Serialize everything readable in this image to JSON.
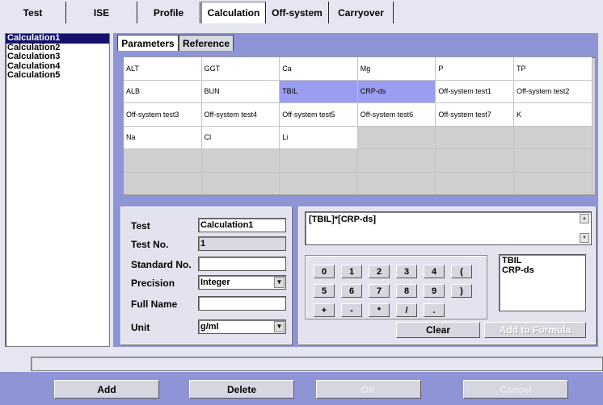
{
  "top_tabs": [
    {
      "label": "Test"
    },
    {
      "label": "ISE"
    },
    {
      "label": "Profile"
    },
    {
      "label": "Calculation",
      "active": true
    },
    {
      "label": "Off-system"
    },
    {
      "label": "Carryover"
    }
  ],
  "calculations": [
    "Calculation1",
    "Calculation2",
    "Calculation3",
    "Calculation4",
    "Calculation5"
  ],
  "selected_calculation": "Calculation1",
  "inner_tabs": [
    {
      "label": "Parameters",
      "active": true
    },
    {
      "label": "Reference"
    }
  ],
  "parameters": [
    [
      "ALT",
      "GGT",
      "Ca",
      "Mg",
      "P",
      "TP"
    ],
    [
      "ALB",
      "BUN",
      "TBIL",
      "CRP-ds",
      "Off-system test1",
      "Off-system test2"
    ],
    [
      "Off-system test3",
      "Off-system test4",
      "Off-system test5",
      "Off-system test6",
      "Off-system test7",
      "K"
    ],
    [
      "Na",
      "Cl",
      "Li",
      "",
      "",
      ""
    ],
    [
      "",
      "",
      "",
      "",
      "",
      ""
    ],
    [
      "",
      "",
      "",
      "",
      "",
      ""
    ]
  ],
  "selected_parameters": [
    "TBIL",
    "CRP-ds"
  ],
  "form": {
    "test_label": "Test",
    "test_value": "Calculation1",
    "test_no_label": "Test No.",
    "test_no_value": "1",
    "standard_no_label": "Standard No.",
    "standard_no_value": "",
    "precision_label": "Precision",
    "precision_value": "Integer",
    "full_name_label": "Full Name",
    "full_name_value": "",
    "unit_label": "Unit",
    "unit_value": "g/ml"
  },
  "formula": "[TBIL]*[CRP-ds]",
  "keypad": [
    [
      "0",
      "1",
      "2",
      "3",
      "4",
      "("
    ],
    [
      "5",
      "6",
      "7",
      "8",
      "9",
      ")"
    ],
    [
      "+",
      "-",
      "*",
      "/",
      "."
    ]
  ],
  "formula_items": [
    "TBIL",
    "CRP-ds"
  ],
  "buttons": {
    "clear": "Clear",
    "add_to_formula": "Add to Formula",
    "add": "Add",
    "delete": "Delete",
    "ok": "OK",
    "cancel": "Cancel"
  },
  "status_text": "",
  "colors": {
    "panel": "#8e94d6",
    "selection": "#9b9df0",
    "list_selection": "#16126b"
  }
}
